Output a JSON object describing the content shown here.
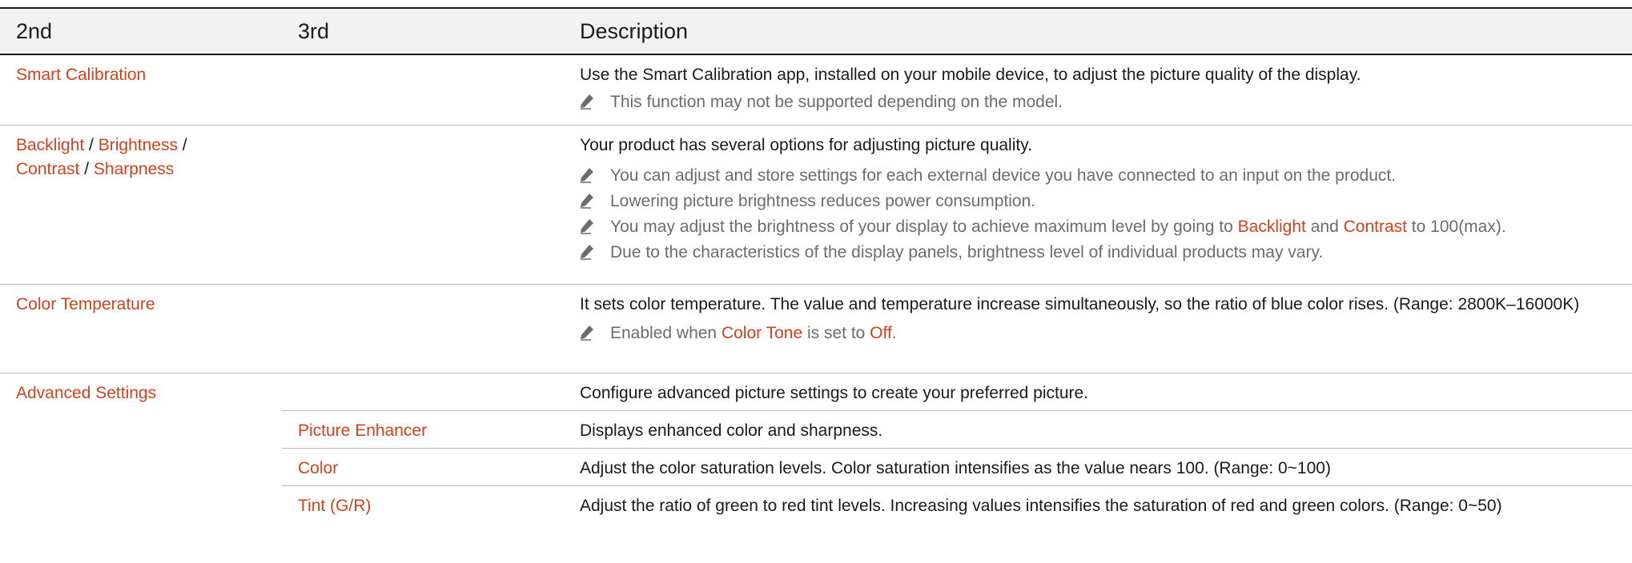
{
  "header": {
    "col2": "2nd",
    "col3": "3rd",
    "col4": "Description"
  },
  "rows": {
    "smart": {
      "label": "Smart Calibration",
      "desc": "Use the Smart Calibration app, installed on your mobile device, to adjust the picture quality of the display.",
      "note1": "This function may not be supported depending on the model."
    },
    "backlight": {
      "l1": "Backlight",
      "s1": " / ",
      "l2": "Brightness",
      "s2": " /",
      "l3": "Contrast",
      "s3": " / ",
      "l4": "Sharpness",
      "desc": "Your product has several options for adjusting picture quality.",
      "note1": "You can adjust and store settings for each external device you have connected to an input on the product.",
      "note2": "Lowering picture brightness reduces power consumption.",
      "note3_a": "You may adjust the brightness of your display to achieve maximum level by going to ",
      "note3_b": "Backlight",
      "note3_c": " and ",
      "note3_d": "Contrast",
      "note3_e": " to 100(max).",
      "note4": "Due to the characteristics of the display panels, brightness level of individual products may vary."
    },
    "colortemp": {
      "label": "Color Temperature",
      "desc": "It sets color temperature. The value and temperature increase simultaneously, so the ratio of blue color rises. (Range: 2800K–16000K)",
      "note_a": "Enabled when ",
      "note_b": "Color Tone",
      "note_c": " is set to ",
      "note_d": "Off",
      "note_e": "."
    },
    "advanced": {
      "label": "Advanced Settings",
      "desc": "Configure advanced picture settings to create your preferred picture.",
      "subs": [
        {
          "label": "Picture Enhancer",
          "desc": "Displays enhanced color and sharpness."
        },
        {
          "label": "Color",
          "desc": "Adjust the color saturation levels. Color saturation intensifies as the value nears 100. (Range: 0~100)"
        },
        {
          "label": "Tint (G/R)",
          "desc": "Adjust the ratio of green to red tint levels. Increasing values intensifies the saturation of red and green colors. (Range: 0~50)"
        }
      ]
    }
  },
  "colors": {
    "accent": "#d5411e",
    "note": "#6c6c6c",
    "header_bg": "#f2f2f2",
    "rule": "#b9b9b9"
  },
  "icons": {
    "note": "pencil-icon"
  }
}
